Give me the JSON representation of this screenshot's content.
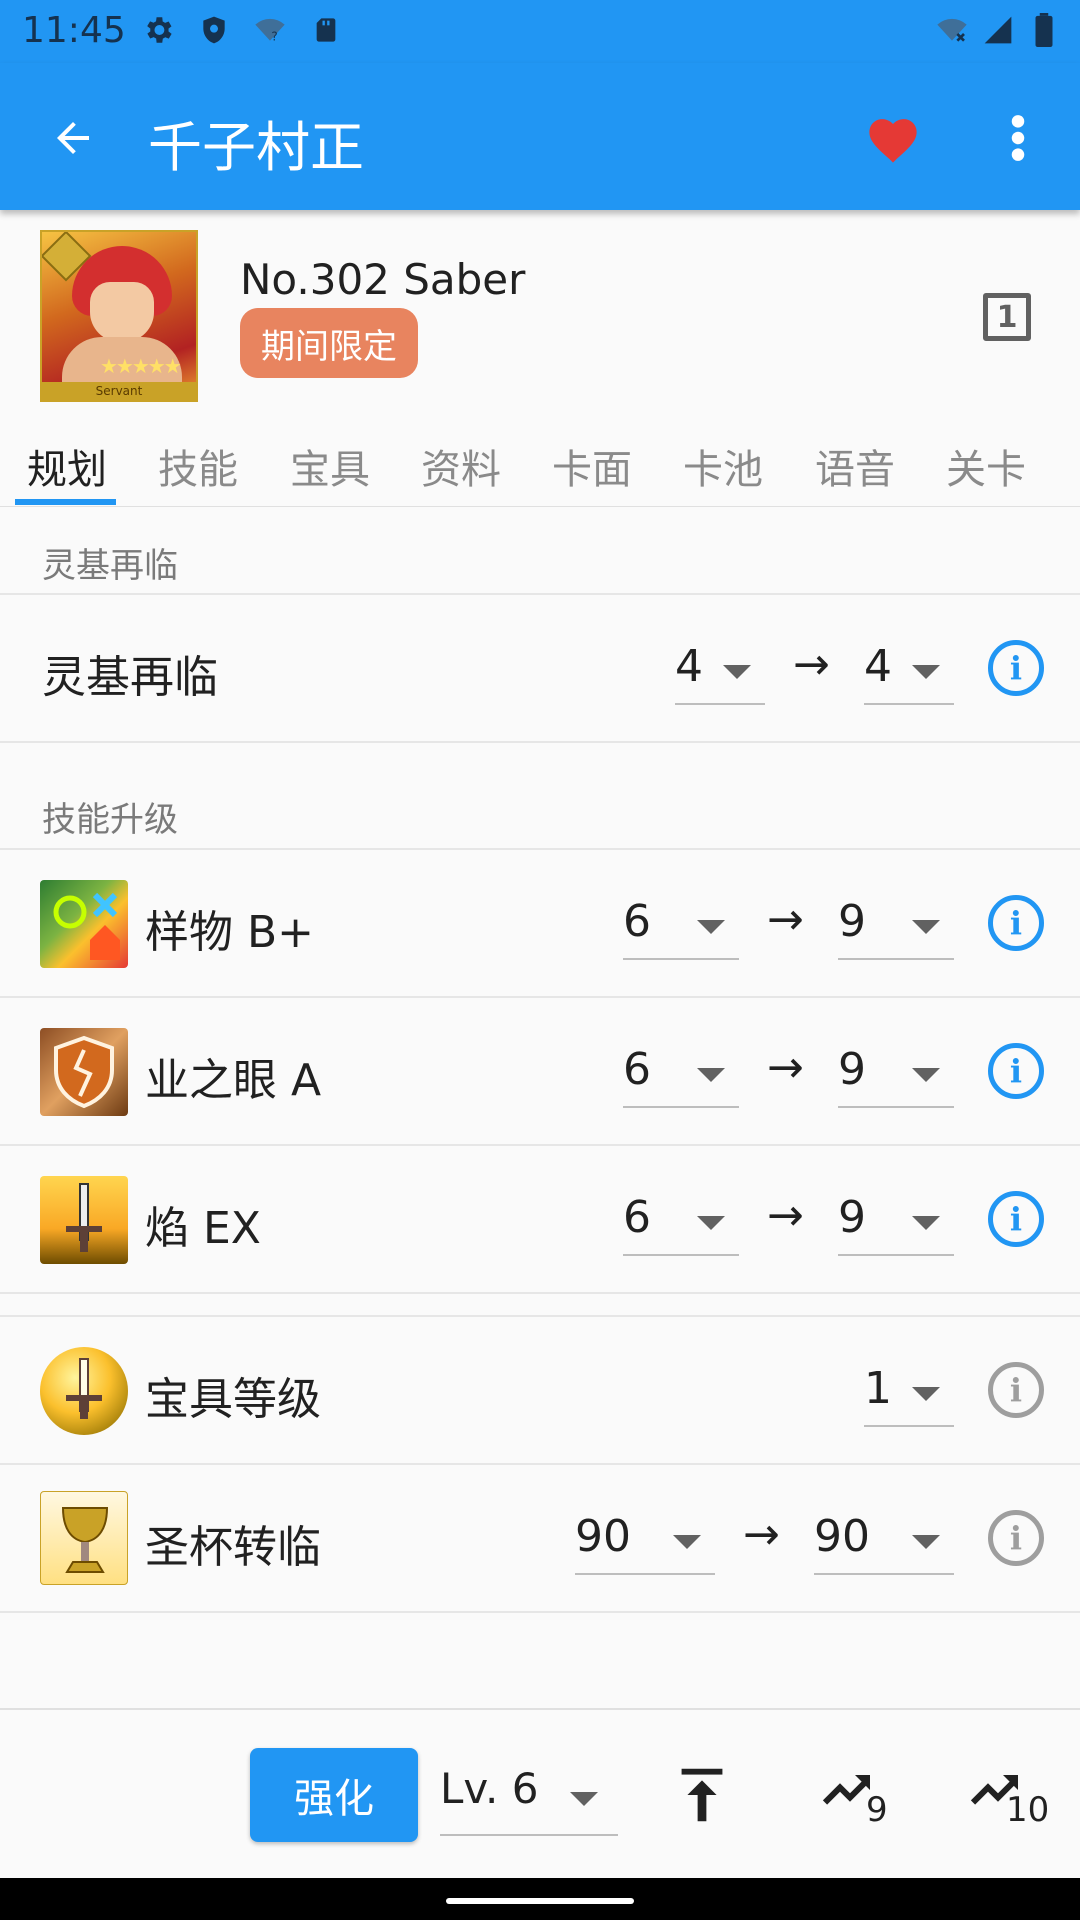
{
  "status_bar": {
    "time": "11:45"
  },
  "app_bar": {
    "title": "千子村正"
  },
  "header": {
    "servant_no": "No.302  Saber",
    "badge": "期间限定",
    "number_icon": "1",
    "avatar_label": "Servant",
    "avatar_stars": "★★★★★"
  },
  "tabs": [
    "规划",
    "技能",
    "宝具",
    "资料",
    "卡面",
    "卡池",
    "语音",
    "关卡"
  ],
  "ascension": {
    "section_title": "灵基再临",
    "row_label": "灵基再临",
    "from": "4",
    "to": "4"
  },
  "skills": {
    "section_title": "技能升级",
    "items": [
      {
        "name": "样物 B+",
        "from": "6",
        "to": "9"
      },
      {
        "name": "业之眼 A",
        "from": "6",
        "to": "9"
      },
      {
        "name": "焰 EX",
        "from": "6",
        "to": "9"
      }
    ]
  },
  "noble_phantasm": {
    "label": "宝具等级",
    "value": "1"
  },
  "grail": {
    "label": "圣杯转临",
    "from": "90",
    "to": "90"
  },
  "arrow": "→",
  "bottom": {
    "enhance_label": "强化",
    "level": "Lv. 6",
    "max9": "9",
    "max10": "10"
  },
  "colors": {
    "primary": "#2196f3",
    "badge": "#e8845f",
    "favorite": "#e53935"
  }
}
